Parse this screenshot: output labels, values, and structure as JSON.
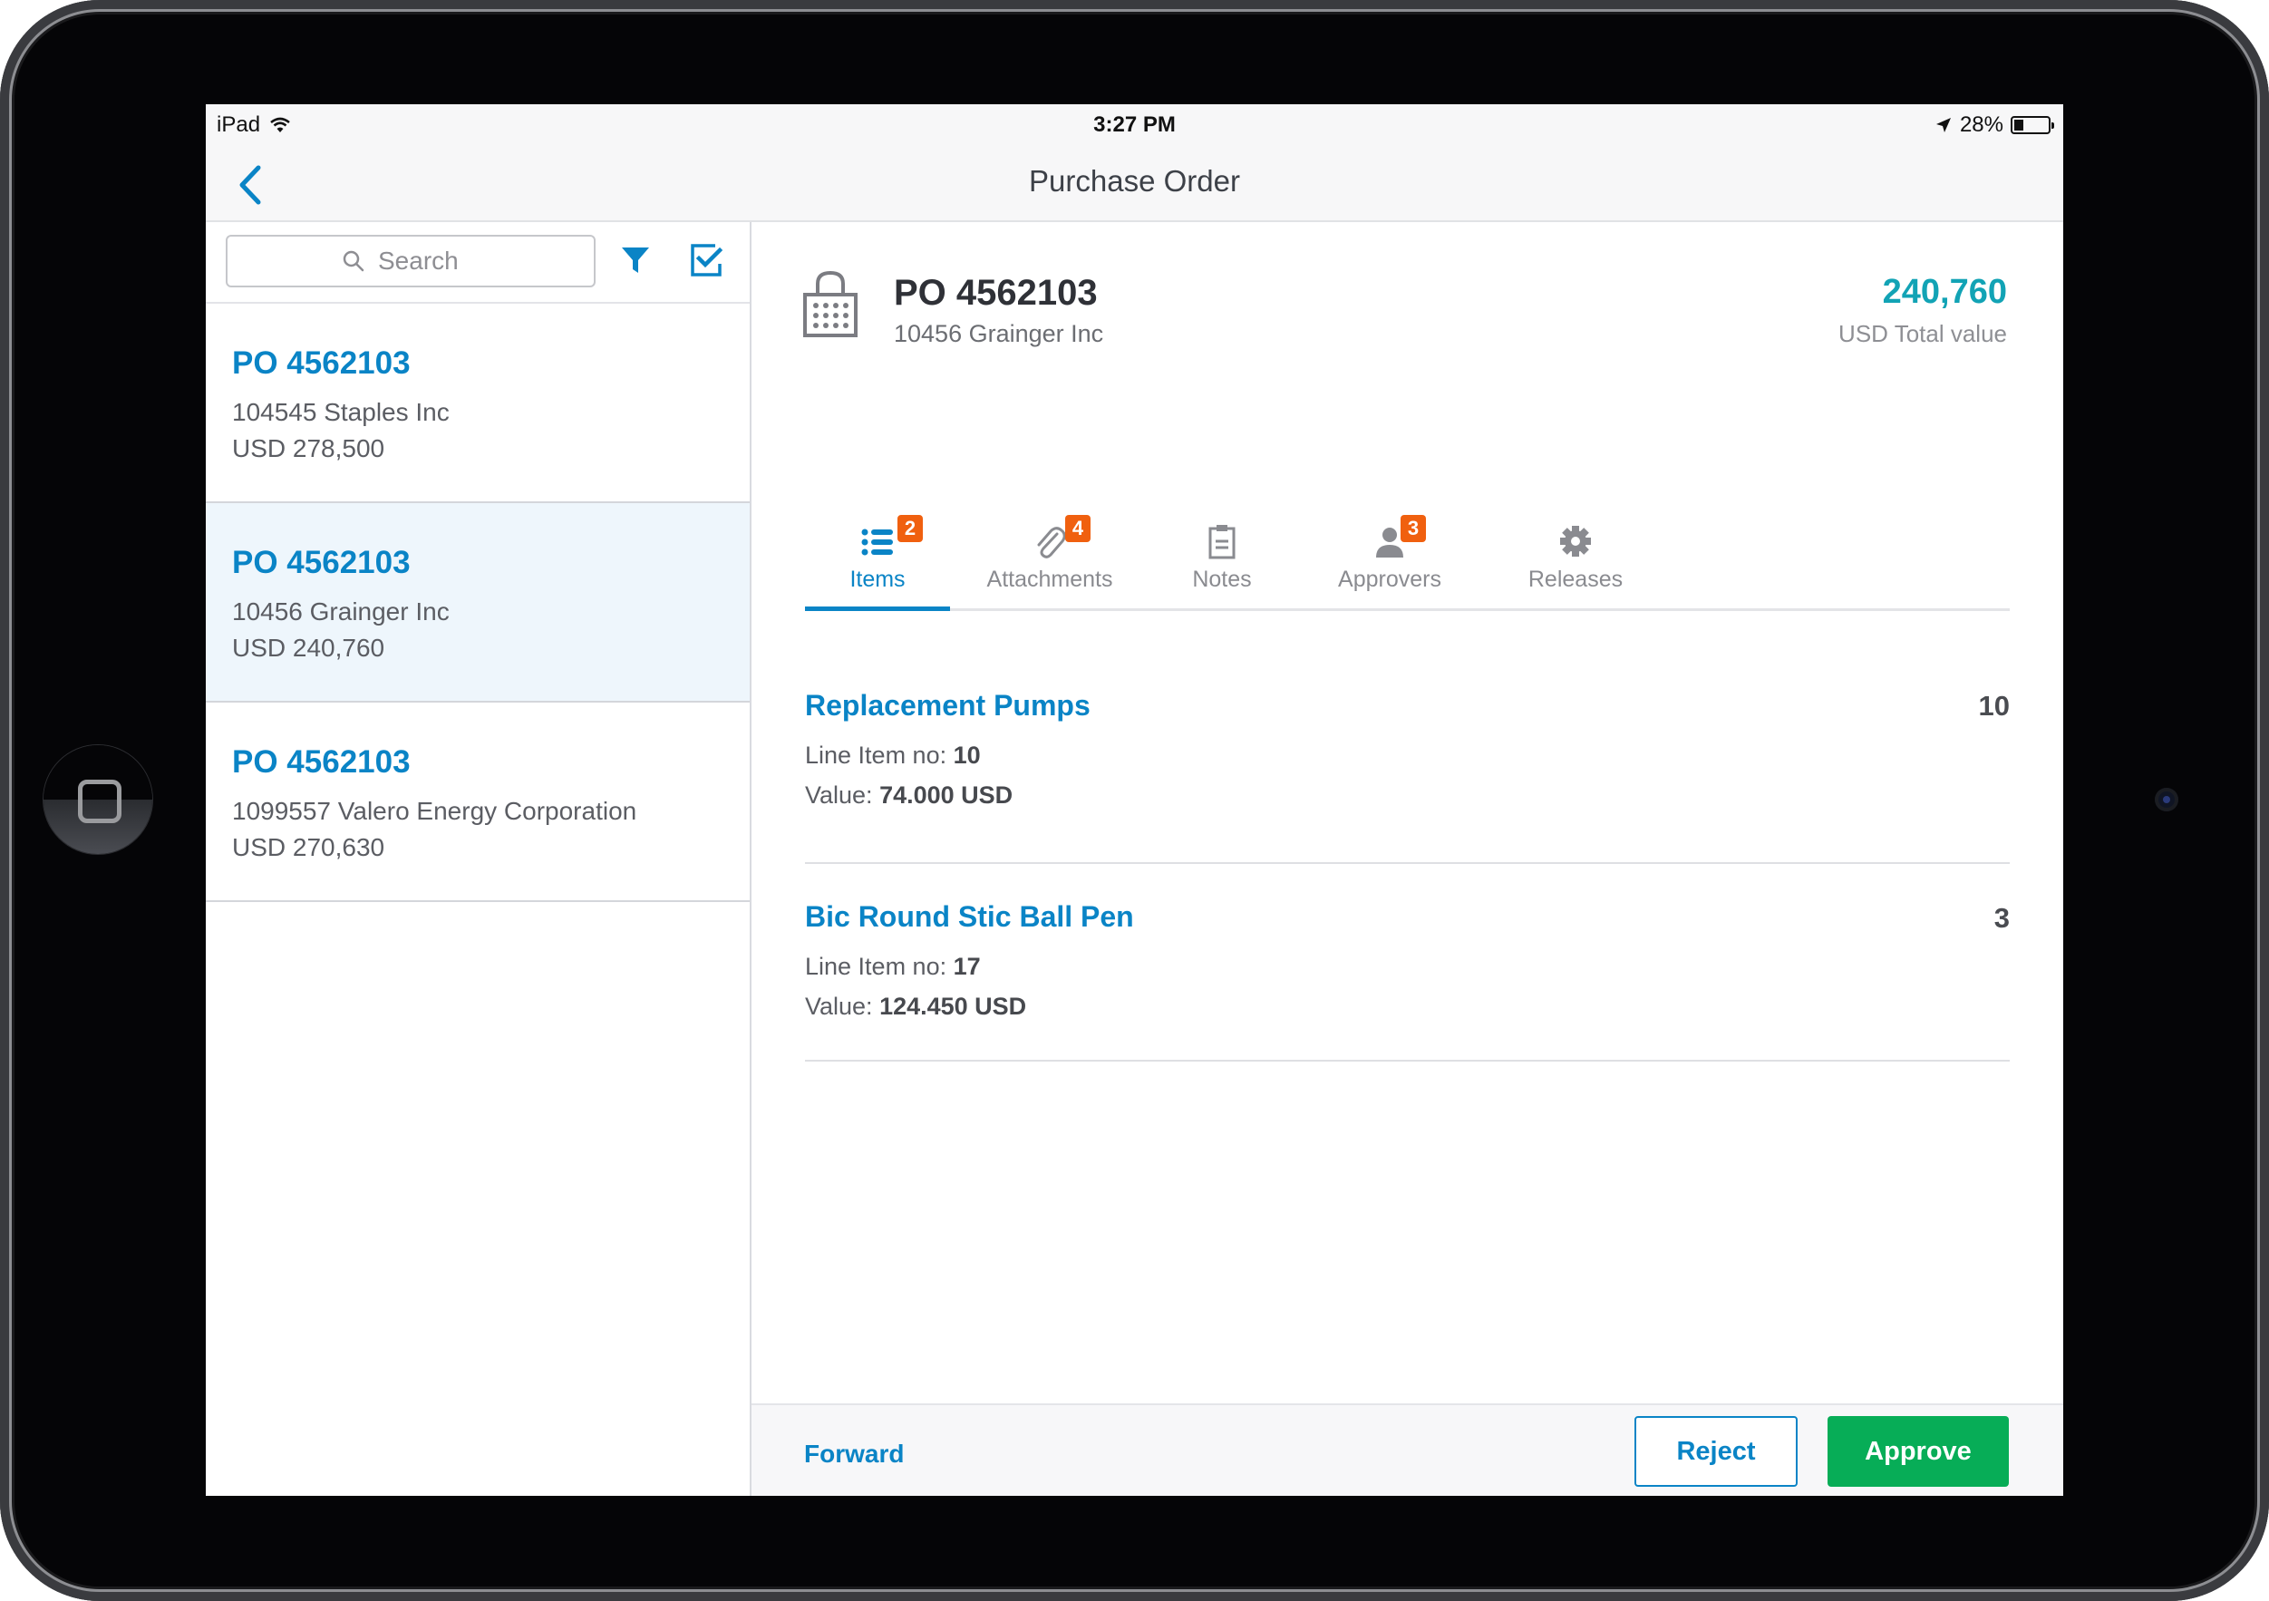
{
  "status_bar": {
    "device": "iPad",
    "time": "3:27 PM",
    "battery_percent_label": "28%",
    "battery_level": 0.28
  },
  "nav": {
    "title": "Purchase Order",
    "back_icon": "chevron-left-icon"
  },
  "sidebar": {
    "search_placeholder": "Search",
    "search_value": "",
    "filter_icon": "filter-icon",
    "select_icon": "checkbox-checked-icon",
    "items": [
      {
        "title": "PO 4562103",
        "vendor": "104545 Staples Inc",
        "amount": "USD 278,500",
        "selected": false
      },
      {
        "title": "PO 4562103",
        "vendor": "10456 Grainger Inc",
        "amount": "USD 240,760",
        "selected": true
      },
      {
        "title": "PO 4562103",
        "vendor": "1099557 Valero Energy Corporation",
        "amount": "USD 270,630",
        "selected": false
      }
    ]
  },
  "detail": {
    "icon": "shopping-bag-icon",
    "title": "PO 4562103",
    "vendor": "10456 Grainger Inc",
    "total_value": "240,760",
    "total_label": "USD Total value",
    "tabs": [
      {
        "label": "Items",
        "icon": "list-icon",
        "badge": "2",
        "active": true
      },
      {
        "label": "Attachments",
        "icon": "paperclip-icon",
        "badge": "4",
        "active": false
      },
      {
        "label": "Notes",
        "icon": "clipboard-icon",
        "badge": null,
        "active": false
      },
      {
        "label": "Approvers",
        "icon": "person-icon",
        "badge": "3",
        "active": false
      },
      {
        "label": "Releases",
        "icon": "gear-icon",
        "badge": null,
        "active": false
      }
    ],
    "line_items": [
      {
        "title": "Replacement Pumps",
        "line_no_label": "Line Item no:",
        "line_no": "10",
        "value_label": "Value:",
        "value": "74.000 USD",
        "quantity": "10"
      },
      {
        "title": "Bic Round Stic Ball Pen",
        "line_no_label": "Line Item no:",
        "line_no": "17",
        "value_label": "Value:",
        "value": "124.450 USD",
        "quantity": "3"
      }
    ]
  },
  "footer": {
    "forward_label": "Forward",
    "reject_label": "Reject",
    "approve_label": "Approve"
  },
  "colors": {
    "accent": "#0a84c6",
    "total_value": "#12a3b5",
    "badge": "#f0600f",
    "approve": "#07ad57",
    "selected_row": "#eef6fc"
  }
}
